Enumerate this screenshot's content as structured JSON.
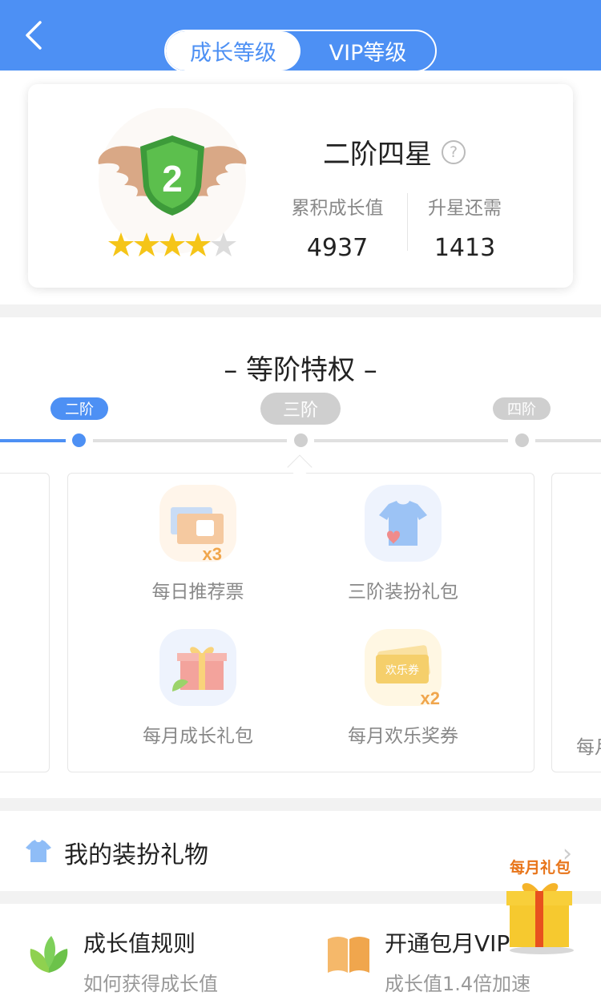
{
  "header": {
    "tabs": [
      {
        "label": "成长等级",
        "active": true
      },
      {
        "label": "VIP等级",
        "active": false
      }
    ]
  },
  "level": {
    "title": "二阶四星",
    "badge_number": "2",
    "stars_filled": 4,
    "stars_total": 5,
    "stats": [
      {
        "label": "累积成长值",
        "value": "4937"
      },
      {
        "label": "升星还需",
        "value": "1413"
      }
    ]
  },
  "privileges": {
    "title": "– 等阶特权 –",
    "tiers": [
      "二阶",
      "三阶",
      "四阶"
    ],
    "selected_tier": "三阶",
    "items": [
      {
        "label": "每日推荐票",
        "badge": "x3",
        "icon": "ticket-thumb-icon"
      },
      {
        "label": "三阶装扮礼包",
        "icon": "shirt-heart-icon"
      },
      {
        "label": "每月成长礼包",
        "icon": "gift-box-icon"
      },
      {
        "label": "每月欢乐奖券",
        "badge": "x2",
        "voucher_text": "欢乐券",
        "icon": "voucher-icon"
      }
    ],
    "next_card_partial_label": "每月"
  },
  "gifts": {
    "label": "我的装扮礼物"
  },
  "bottom": [
    {
      "title": "成长值规则",
      "subtitle": "如何获得成长值",
      "icon": "leaf-icon"
    },
    {
      "title": "开通包月VIP",
      "subtitle": "成长值1.4倍加速",
      "icon": "book-icon"
    }
  ],
  "floating_gift": {
    "label": "每月礼包"
  },
  "colors": {
    "primary": "#4d90f4",
    "gray_pill": "#cfcfcf",
    "star": "#f5c518",
    "badge_green": "#4caf50"
  }
}
